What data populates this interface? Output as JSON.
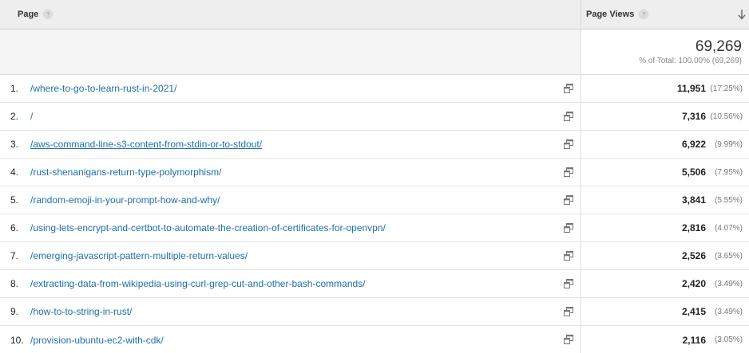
{
  "header": {
    "page_label": "Page",
    "views_label": "Page Views",
    "help": "?"
  },
  "totals": {
    "value": "69,269",
    "sub": "% of Total: 100.00% (69,269)"
  },
  "rows": [
    {
      "num": "1.",
      "page": "/where-to-go-to-learn-rust-in-2021/",
      "views": "11,951",
      "pct": "(17.25%)"
    },
    {
      "num": "2.",
      "page": "/",
      "views": "7,316",
      "pct": "(10.56%)"
    },
    {
      "num": "3.",
      "page": "/aws-command-line-s3-content-from-stdin-or-to-stdout/",
      "views": "6,922",
      "pct": "(9.99%)"
    },
    {
      "num": "4.",
      "page": "/rust-shenanigans-return-type-polymorphism/",
      "views": "5,506",
      "pct": "(7.95%)"
    },
    {
      "num": "5.",
      "page": "/random-emoji-in-your-prompt-how-and-why/",
      "views": "3,841",
      "pct": "(5.55%)"
    },
    {
      "num": "6.",
      "page": "/using-lets-encrypt-and-certbot-to-automate-the-creation-of-certificates-for-openvpn/",
      "views": "2,816",
      "pct": "(4.07%)"
    },
    {
      "num": "7.",
      "page": "/emerging-javascript-pattern-multiple-return-values/",
      "views": "2,526",
      "pct": "(3.65%)"
    },
    {
      "num": "8.",
      "page": "/extracting-data-from-wikipedia-using-curl-grep-cut-and-other-bash-commands/",
      "views": "2,420",
      "pct": "(3.49%)"
    },
    {
      "num": "9.",
      "page": "/how-to-to-string-in-rust/",
      "views": "2,415",
      "pct": "(3.49%)"
    },
    {
      "num": "10.",
      "page": "/provision-ubuntu-ec2-with-cdk/",
      "views": "2,116",
      "pct": "(3.05%)"
    }
  ],
  "icons": {
    "help": "help-icon",
    "sort": "sort-descending-icon",
    "external": "open-in-new-window-icon"
  },
  "colors": {
    "link": "#1c6fa8",
    "header_bg": "#eeeeee"
  }
}
